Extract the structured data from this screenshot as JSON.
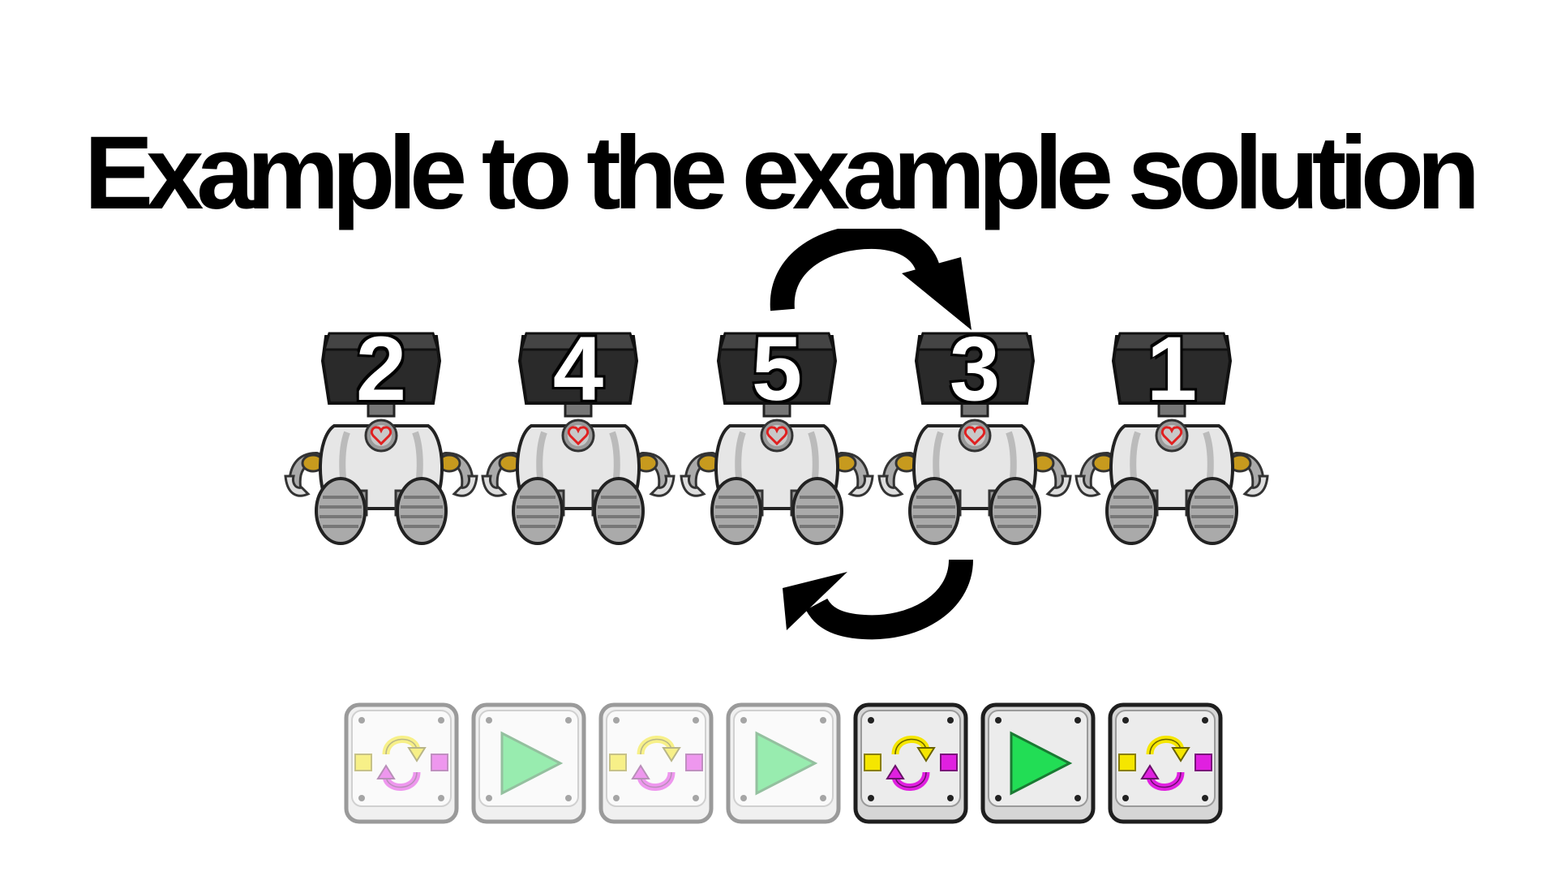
{
  "title": "Example to the example solution",
  "robots": [
    {
      "number": "2"
    },
    {
      "number": "4"
    },
    {
      "number": "5"
    },
    {
      "number": "3"
    },
    {
      "number": "1"
    }
  ],
  "swap_arrows": {
    "from_robot": "5",
    "to_robot": "3"
  },
  "command_tiles": [
    {
      "type": "swap",
      "state": "faded"
    },
    {
      "type": "play",
      "state": "faded"
    },
    {
      "type": "swap",
      "state": "faded"
    },
    {
      "type": "play",
      "state": "faded"
    },
    {
      "type": "swap",
      "state": "active"
    },
    {
      "type": "play",
      "state": "active"
    },
    {
      "type": "swap",
      "state": "active"
    }
  ],
  "colors": {
    "swap_yellow": "#f5e600",
    "swap_magenta": "#e020e0",
    "play_green": "#22dd55",
    "heart_red": "#e02020"
  }
}
